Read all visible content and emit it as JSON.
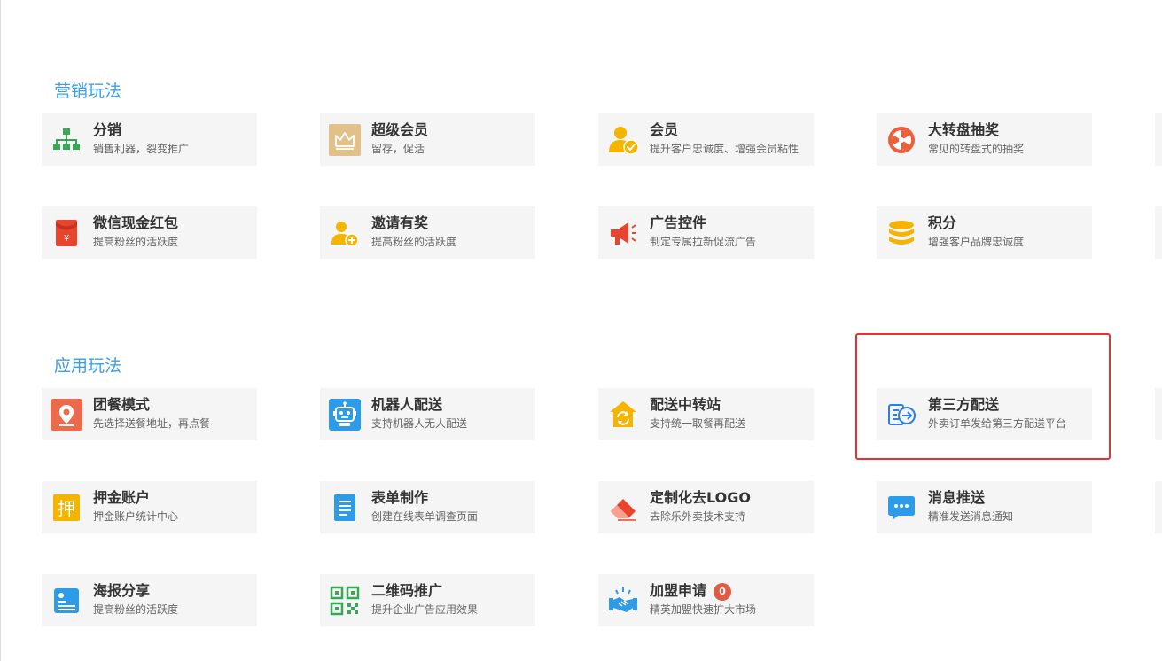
{
  "sections": {
    "marketing": {
      "title": "营销玩法",
      "cards": [
        {
          "title": "分销",
          "desc": "销售利器，裂变推广",
          "icon": "org-chart-icon"
        },
        {
          "title": "超级会员",
          "desc": "留存，促活",
          "icon": "crown-icon"
        },
        {
          "title": "会员",
          "desc": "提升客户忠诚度、增强会员粘性",
          "icon": "member-icon"
        },
        {
          "title": "大转盘抽奖",
          "desc": "常见的转盘式的抽奖",
          "icon": "wheel-icon"
        },
        {
          "title": "微信现金红包",
          "desc": "提高粉丝的活跃度",
          "icon": "red-envelope-icon"
        },
        {
          "title": "邀请有奖",
          "desc": "提高粉丝的活跃度",
          "icon": "invite-user-icon"
        },
        {
          "title": "广告控件",
          "desc": "制定专属拉新促流广告",
          "icon": "megaphone-icon"
        },
        {
          "title": "积分",
          "desc": "增强客户品牌忠诚度",
          "icon": "coins-icon"
        }
      ]
    },
    "application": {
      "title": "应用玩法",
      "cards": [
        {
          "title": "团餐模式",
          "desc": "先选择送餐地址，再点餐",
          "icon": "location-pin-icon"
        },
        {
          "title": "机器人配送",
          "desc": "支持机器人无人配送",
          "icon": "robot-icon"
        },
        {
          "title": "配送中转站",
          "desc": "支持统一取餐再配送",
          "icon": "transfer-station-icon"
        },
        {
          "title": "第三方配送",
          "desc": "外卖订单发给第三方配送平台",
          "icon": "third-party-delivery-icon"
        },
        {
          "title": "押金账户",
          "desc": "押金账户统计中心",
          "icon": "deposit-icon",
          "glyph": "押"
        },
        {
          "title": "表单制作",
          "desc": "创建在线表单调查页面",
          "icon": "form-icon"
        },
        {
          "title": "定制化去LOGO",
          "desc": "去除乐外卖技术支持",
          "icon": "eraser-icon"
        },
        {
          "title": "消息推送",
          "desc": "精准发送消息通知",
          "icon": "message-icon"
        },
        {
          "title": "海报分享",
          "desc": "提高粉丝的活跃度",
          "icon": "poster-icon"
        },
        {
          "title": "二维码推广",
          "desc": "提升企业广告应用效果",
          "icon": "qrcode-icon"
        },
        {
          "title": "加盟申请",
          "desc": "精英加盟快速扩大市场",
          "icon": "handshake-icon",
          "badge": "0"
        }
      ]
    }
  },
  "colors": {
    "section_title": "#3d9ee8",
    "card_bg": "#f5f5f5",
    "highlight_border": "#e6312e",
    "badge": "#e05a44"
  }
}
